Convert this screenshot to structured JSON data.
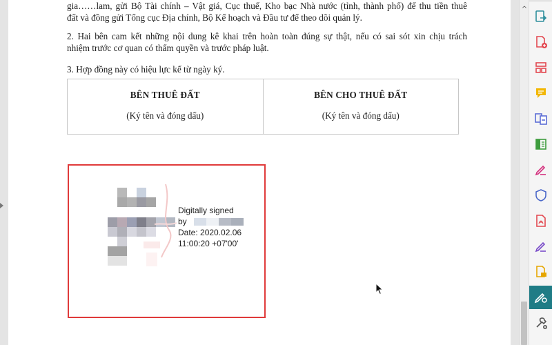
{
  "document": {
    "para1_lines": [
      "gia……lam, gửi Bộ Tài chính – Vật giá, Cục thuế, Kho bạc Nhà nước (tỉnh, thành phố) để thu tiền thuê",
      "đất và đồng gửi Tổng cục Địa chính, Bộ Kế hoạch và Đầu tư để theo dõi quản lý."
    ],
    "para2_lines": [
      "2. Hai bên cam kết những nội dung kê khai trên hoàn toàn đúng sự thật, nếu có sai sót xin chịu trách",
      "nhiệm trước cơ quan có thẩm quyền và trước pháp luật."
    ],
    "para3": "3. Hợp đồng này có hiệu lực kể từ ngày ký.",
    "table": {
      "left": {
        "title": "BÊN THUÊ ĐẤT",
        "subtitle": "(Ký tên và đóng dấu)"
      },
      "right": {
        "title": "BÊN CHO THUÊ ĐẤT",
        "subtitle": "(Ký tên và đóng dấu)"
      }
    }
  },
  "signature": {
    "line1": "Digitally signed",
    "line2": "by",
    "line3": "Date: 2020.02.06",
    "line4": "11:00:20 +07'00'",
    "frame_color": "#e03a3a"
  },
  "scrollbar": {
    "up_arrow": "^"
  },
  "toolbar": {
    "active_color": "#1f7c86",
    "tools": [
      {
        "name": "export-pdf-icon",
        "color": "#2f8f9d"
      },
      {
        "name": "create-pdf-icon",
        "color": "#e34850"
      },
      {
        "name": "organize-pages-icon",
        "color": "#e34850"
      },
      {
        "name": "comment-icon",
        "color": "#f2b705"
      },
      {
        "name": "combine-files-icon",
        "color": "#5b6dd6"
      },
      {
        "name": "compare-files-icon",
        "color": "#3d9c3d"
      },
      {
        "name": "fill-sign-icon",
        "color": "#d4317e"
      },
      {
        "name": "protect-icon",
        "color": "#4a67c9"
      },
      {
        "name": "export-pdf-red-icon",
        "color": "#e34850"
      },
      {
        "name": "send-for-signature-icon",
        "color": "#7a4dc9"
      },
      {
        "name": "send-track-icon",
        "color": "#e6a600"
      },
      {
        "name": "certificates-icon",
        "color": "#ffffff"
      },
      {
        "name": "more-tools-icon",
        "color": "#555555"
      }
    ]
  }
}
